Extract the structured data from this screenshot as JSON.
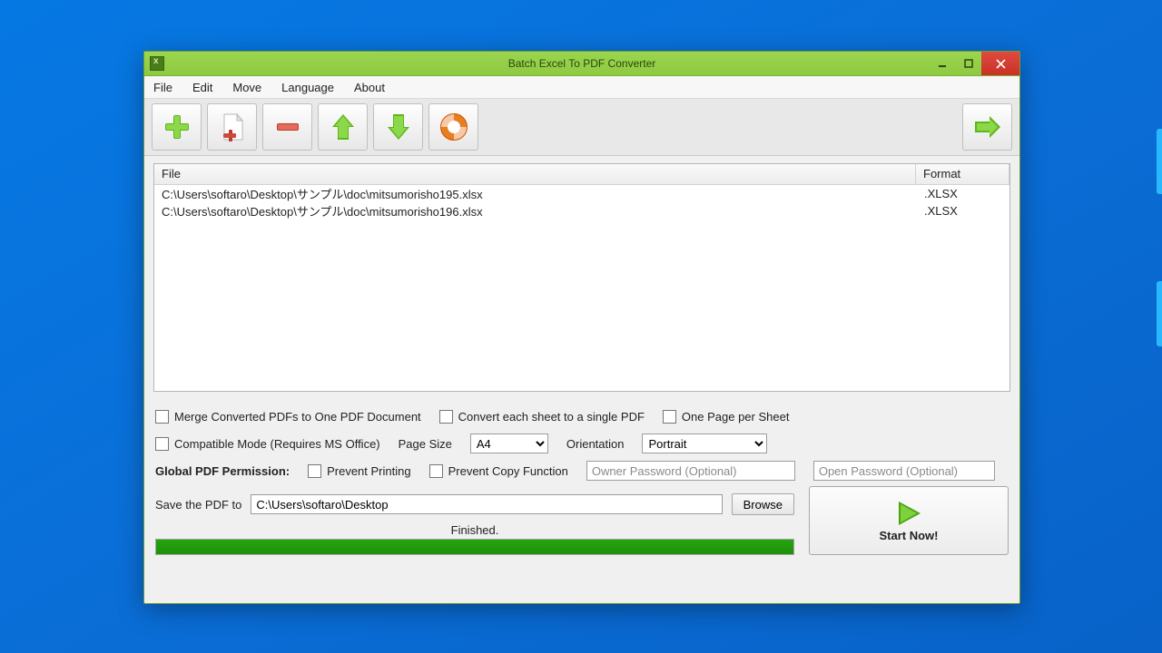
{
  "window": {
    "title": "Batch Excel To PDF Converter"
  },
  "menu": {
    "items": [
      "File",
      "Edit",
      "Move",
      "Language",
      "About"
    ]
  },
  "toolbar": {
    "icons": [
      "add-icon",
      "add-file-icon",
      "remove-icon",
      "move-up-icon",
      "move-down-icon",
      "help-icon",
      "convert-icon"
    ]
  },
  "filelist": {
    "headers": {
      "file": "File",
      "format": "Format"
    },
    "rows": [
      {
        "file": "C:\\Users\\softaro\\Desktop\\サンプル\\doc\\mitsumorisho195.xlsx",
        "format": ".XLSX"
      },
      {
        "file": "C:\\Users\\softaro\\Desktop\\サンプル\\doc\\mitsumorisho196.xlsx",
        "format": ".XLSX"
      }
    ]
  },
  "options": {
    "merge": "Merge Converted PDFs to One PDF Document",
    "eachSheet": "Convert each sheet to a single PDF",
    "onePage": "One Page per Sheet",
    "compat": "Compatible Mode (Requires MS Office)",
    "pageSizeLabel": "Page Size",
    "pageSizeValue": "A4",
    "orientationLabel": "Orientation",
    "orientationValue": "Portrait",
    "permLabel": "Global PDF Permission:",
    "preventPrint": "Prevent Printing",
    "preventCopy": "Prevent Copy Function",
    "ownerPwdPlaceholder": "Owner Password (Optional)",
    "openPwdPlaceholder": "Open Password (Optional)"
  },
  "output": {
    "saveLabel": "Save the PDF to",
    "savePath": "C:\\Users\\softaro\\Desktop",
    "browse": "Browse",
    "status": "Finished.",
    "progressPct": 100,
    "startLabel": "Start Now!"
  }
}
